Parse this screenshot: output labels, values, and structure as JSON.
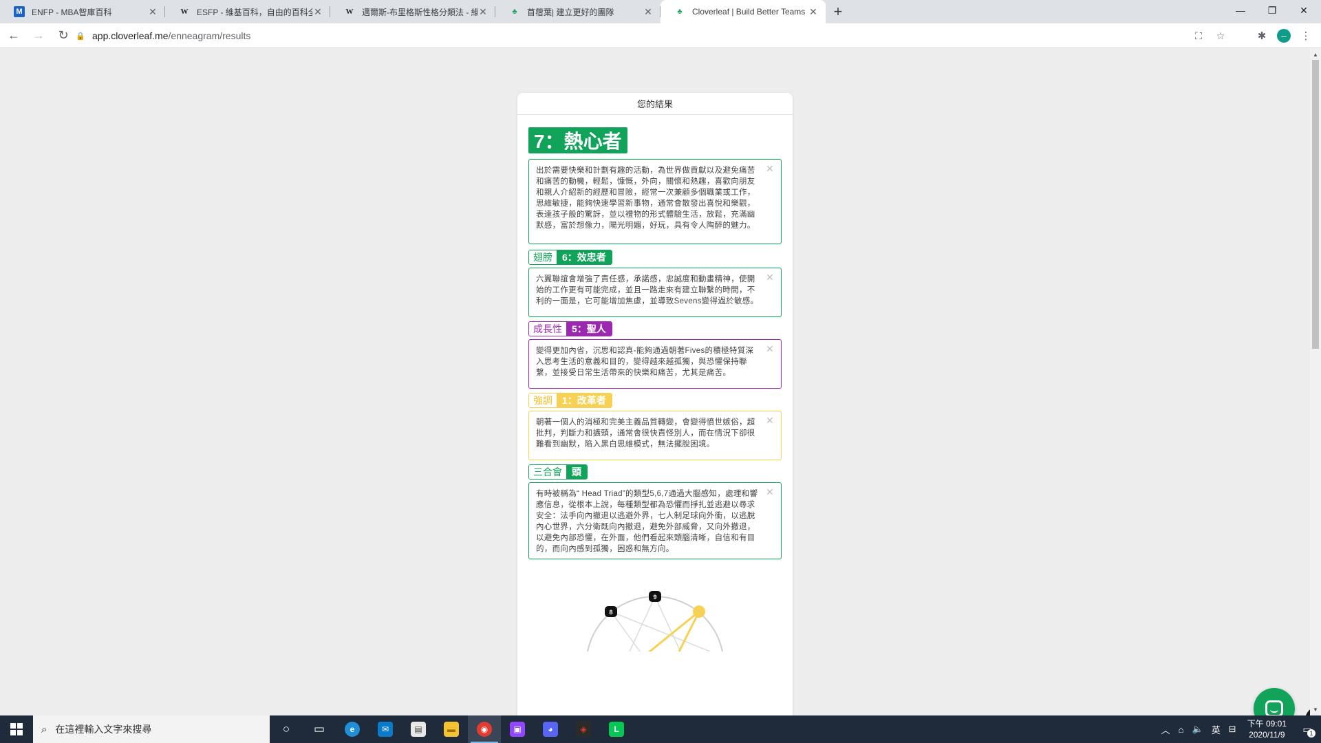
{
  "browser": {
    "tabs": [
      {
        "title": "ENFP - MBA智庫百科",
        "icon": "m-icon"
      },
      {
        "title": "ESFP - 維基百科，自由的百科全書",
        "icon": "w-icon"
      },
      {
        "title": "邁爾斯-布里格斯性格分類法 - 維基百科",
        "icon": "w-icon"
      },
      {
        "title": "苜蓿葉| 建立更好的團隊",
        "icon": "leaf-icon"
      },
      {
        "title": "Cloverleaf | Build Better Teams",
        "icon": "leaf-icon"
      }
    ],
    "url_host": "app.cloverleaf.me",
    "url_path": "/enneagram/results"
  },
  "page": {
    "header": "您的結果",
    "type_title": "7：熱心者",
    "type_desc": "出於需要快樂和計劃有趣的活動，為世界做貢獻以及避免痛苦和痛苦的動機，輕鬆，慷慨，外向，關懷和熱趣，喜歡向朋友和親人介紹新的經歷和冒險，經常一次兼顧多個職業或工作，思維敏捷，能夠快速學習新事物，通常會散發出喜悅和樂觀，表達孩子般的驚訝，並以禮物的形式體驗生活，放鬆，充滿幽默感，富於想像力，陽光明媚，好玩，具有令人陶醉的魅力。",
    "wing": {
      "label": "翅膀",
      "value": "6：效忠者",
      "desc": "六翼聯誼會增強了責任感，承諾感，忠誠度和動畫精神，使開始的工作更有可能完成，並且一路走來有建立聯繫的時間，不利的一面是，它可能增加焦慮，並導致Sevens變得過於敏感。"
    },
    "growth": {
      "label": "成長性",
      "value": "5：聖人",
      "desc": "變得更加內省，沉思和認真-能夠通過朝著Fives的積極特質深入思考生活的意義和目的，變得越來越孤獨，與恐懼保持聯繫，並接受日常生活帶來的快樂和痛苦，尤其是痛苦。"
    },
    "stress": {
      "label": "強調",
      "value": "1：改革者",
      "desc": "朝著一個人的消極和完美主義品質轉變，會變得憤世嫉俗，超批判，判斷力和擴頭，通常會很快責怪別人，而在情況下卻很難看到幽默，陷入黑白思維模式，無法擺脫困境。"
    },
    "triad": {
      "label": "三合會",
      "value": "頭",
      "desc": "有時被稱為“ Head Triad”的類型5,6,7通過大腦感知，處理和響應信息，從根本上說，每種類型都為恐懼而掙扎並逃避以尋求安全：法手向內撤退以逃避外界，七人制足球向外衝，以逃脫內心世界，六分衛既向內撤退，避免外部威脅，又向外撤退，以避免內部恐懼，在外面，他們看起來頭腦清晰，自信和有目的，而向內感到孤獨，困惑和無方向。"
    },
    "enneagram_nodes": [
      "9",
      "8"
    ],
    "colors": {
      "green": "#12a35a",
      "purple": "#9c27b0",
      "yellow": "#f7d154"
    }
  },
  "taskbar": {
    "search_placeholder": "在這裡輸入文字來搜尋",
    "lang": "英",
    "time": "下午 09:01",
    "date": "2020/11/9",
    "notif_count": "1"
  }
}
